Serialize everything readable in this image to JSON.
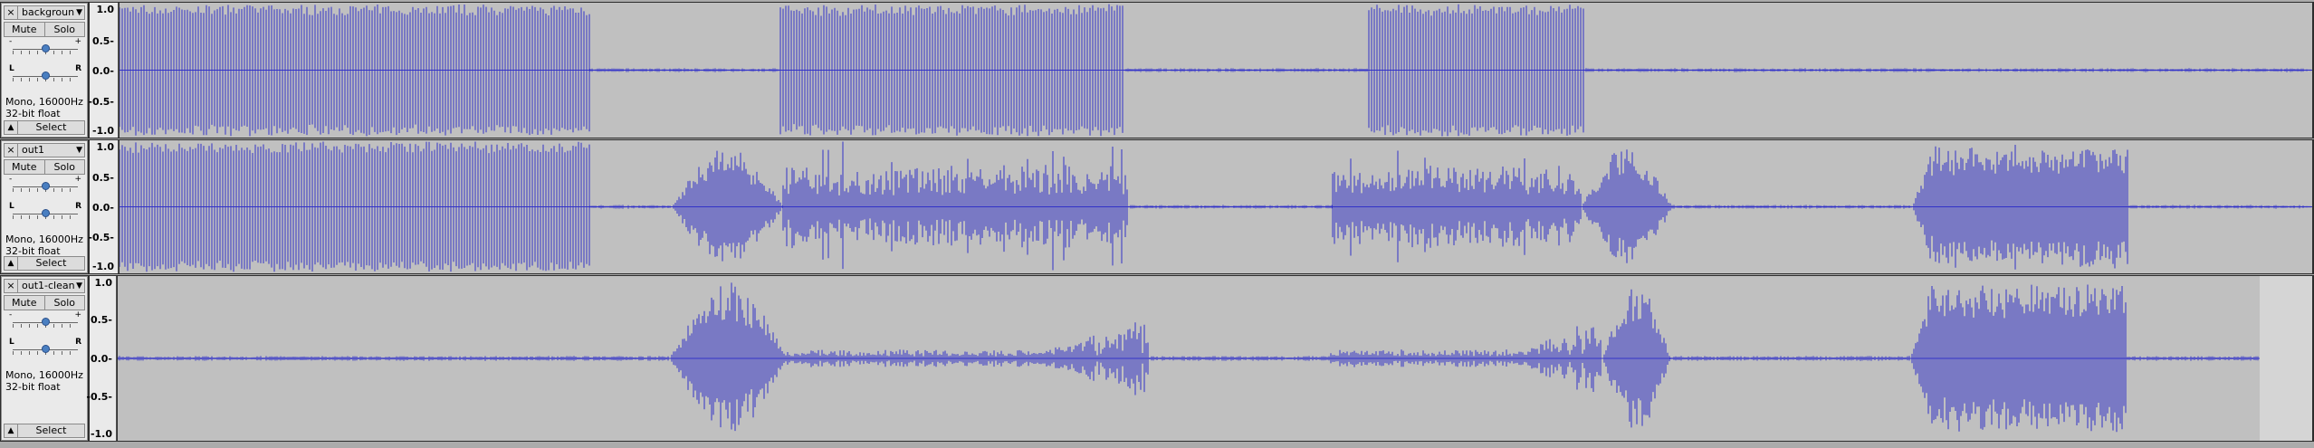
{
  "tracks": [
    {
      "name": "backgroun",
      "mute": "Mute",
      "solo": "Solo",
      "gain_minus": "-",
      "gain_plus": "+",
      "pan_left": "L",
      "pan_right": "R",
      "format_line1": "Mono, 16000Hz",
      "format_line2": "32-bit float",
      "select": "Select",
      "scale": [
        "1.0",
        "0.5-",
        "0.0-",
        "-0.5-",
        "-1.0"
      ]
    },
    {
      "name": "out1",
      "mute": "Mute",
      "solo": "Solo",
      "gain_minus": "-",
      "gain_plus": "+",
      "pan_left": "L",
      "pan_right": "R",
      "format_line1": "Mono, 16000Hz",
      "format_line2": "32-bit float",
      "select": "Select",
      "scale": [
        "1.0",
        "0.5-",
        "0.0-",
        "-0.5-",
        "-1.0"
      ]
    },
    {
      "name": "out1-clean",
      "mute": "Mute",
      "solo": "Solo",
      "gain_minus": "-",
      "gain_plus": "+",
      "pan_left": "L",
      "pan_right": "R",
      "format_line1": "Mono, 16000Hz",
      "format_line2": "32-bit float",
      "select": "Select",
      "scale": [
        "1.0",
        "0.5-",
        "0.0-",
        "-0.5-",
        "-1.0"
      ]
    }
  ],
  "icons": {
    "close": "×",
    "dropdown": "▼",
    "collapse": "▲"
  },
  "colors": {
    "waveform": "#3232c8",
    "waveform_background": "#c0c0c0",
    "panel": "#eaeaea"
  }
}
